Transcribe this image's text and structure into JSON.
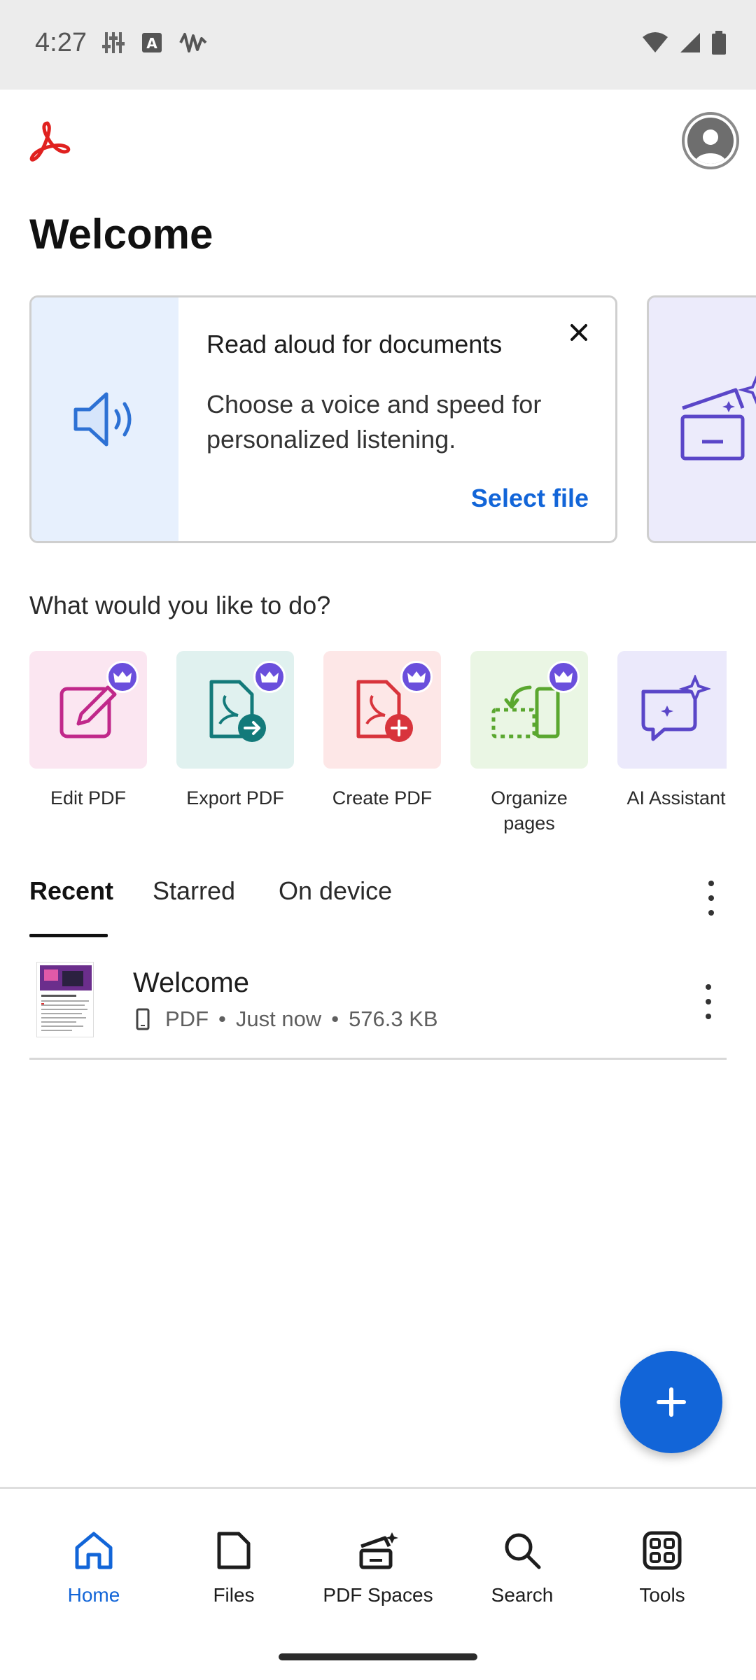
{
  "status_bar": {
    "time": "4:27"
  },
  "header": {
    "title": "Welcome"
  },
  "promo": {
    "title": "Read aloud for documents",
    "description": "Choose a voice and speed for personalized listening.",
    "cta": "Select file"
  },
  "quick_actions": {
    "heading": "What would you like to do?",
    "items": [
      {
        "label": "Edit PDF",
        "icon": "edit-pdf-icon",
        "color": "#c0288a",
        "bg": "#fbe6f1"
      },
      {
        "label": "Export PDF",
        "icon": "export-pdf-icon",
        "color": "#137a7a",
        "bg": "#e0f1ef"
      },
      {
        "label": "Create PDF",
        "icon": "create-pdf-icon",
        "color": "#d8343c",
        "bg": "#fde7e7"
      },
      {
        "label": "Organize pages",
        "icon": "organize-pages-icon",
        "color": "#5aa72f",
        "bg": "#eaf6e4"
      },
      {
        "label": "AI Assistant",
        "icon": "ai-assistant-icon",
        "color": "#5a46c8",
        "bg": "#ebe9fb"
      }
    ]
  },
  "tabs": [
    {
      "label": "Recent",
      "active": true
    },
    {
      "label": "Starred",
      "active": false
    },
    {
      "label": "On device",
      "active": false
    }
  ],
  "files": [
    {
      "name": "Welcome",
      "type": "PDF",
      "modified": "Just now",
      "size": "576.3 KB"
    }
  ],
  "bottom_nav": [
    {
      "label": "Home",
      "icon": "home-icon",
      "active": true
    },
    {
      "label": "Files",
      "icon": "files-icon",
      "active": false
    },
    {
      "label": "PDF Spaces",
      "icon": "pdf-spaces-icon",
      "active": false
    },
    {
      "label": "Search",
      "icon": "search-icon",
      "active": false
    },
    {
      "label": "Tools",
      "icon": "tools-icon",
      "active": false
    }
  ],
  "colors": {
    "accent": "#1265d8",
    "brand_red": "#e0211f",
    "badge": "#6a4fdc"
  }
}
